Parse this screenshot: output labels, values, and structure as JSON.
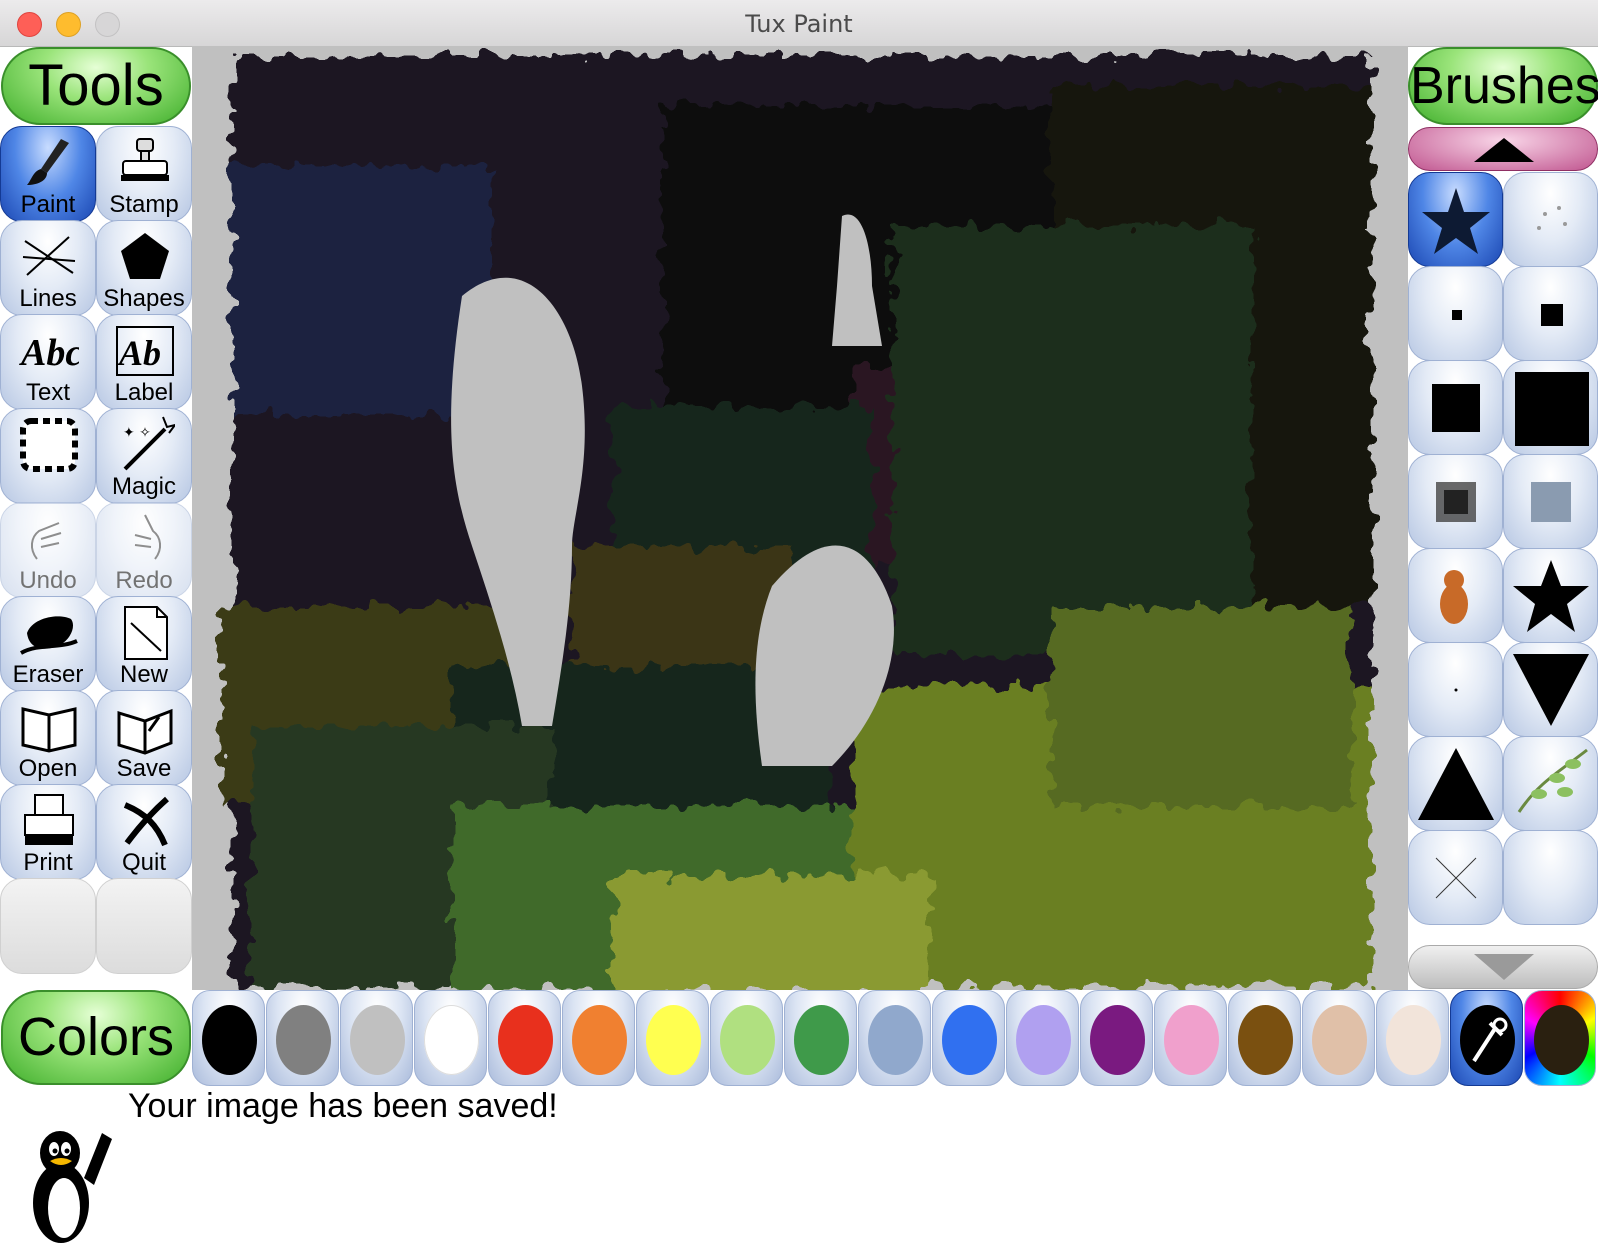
{
  "window": {
    "title": "Tux Paint"
  },
  "tools": {
    "header": "Tools",
    "items": [
      {
        "label": "Paint",
        "icon": "paintbrush-icon",
        "selected": true
      },
      {
        "label": "Stamp",
        "icon": "stamp-icon"
      },
      {
        "label": "Lines",
        "icon": "lines-icon"
      },
      {
        "label": "Shapes",
        "icon": "pentagon-icon"
      },
      {
        "label": "Text",
        "icon": "text-abc-icon"
      },
      {
        "label": "Label",
        "icon": "label-icon"
      },
      {
        "label": "",
        "icon": "fill-icon"
      },
      {
        "label": "Magic",
        "icon": "magic-wand-icon"
      },
      {
        "label": "Undo",
        "icon": "undo-hand-icon",
        "disabled": true
      },
      {
        "label": "Redo",
        "icon": "redo-hand-icon",
        "disabled": true
      },
      {
        "label": "Eraser",
        "icon": "eraser-icon"
      },
      {
        "label": "New",
        "icon": "new-page-icon"
      },
      {
        "label": "Open",
        "icon": "open-book-icon"
      },
      {
        "label": "Save",
        "icon": "save-book-icon"
      },
      {
        "label": "Print",
        "icon": "printer-icon"
      },
      {
        "label": "Quit",
        "icon": "quit-x-icon"
      }
    ]
  },
  "brushes": {
    "header": "Brushes",
    "items": [
      {
        "icon": "starfish-brush-icon",
        "selected": true
      },
      {
        "icon": "spray-brush-icon"
      },
      {
        "icon": "small-square-brush-icon"
      },
      {
        "icon": "medium-square-brush-icon"
      },
      {
        "icon": "large-square-brush-icon"
      },
      {
        "icon": "xlarge-square-brush-icon"
      },
      {
        "icon": "fuzzy-square-brush-icon"
      },
      {
        "icon": "soft-square-brush-icon"
      },
      {
        "icon": "squirrel-brush-icon"
      },
      {
        "icon": "star-brush-icon"
      },
      {
        "icon": "dot-brush-icon"
      },
      {
        "icon": "triangle-down-brush-icon"
      },
      {
        "icon": "triangle-up-brush-icon"
      },
      {
        "icon": "vine-brush-icon"
      },
      {
        "icon": "cross-brush-icon"
      },
      {
        "icon": "empty-brush-icon"
      }
    ]
  },
  "colors": {
    "header": "Colors",
    "swatches": [
      "#000000",
      "#808080",
      "#c0c0c0",
      "#ffffff",
      "#e8301d",
      "#f08030",
      "#ffff50",
      "#b0e080",
      "#3f9a4a",
      "#90a8cc",
      "#3070f0",
      "#b0a0f0",
      "#7a1a80",
      "#f0a0cc",
      "#7a5010",
      "#e0c0a8",
      "#f2e4da"
    ],
    "picker_icon": "eyedropper-icon",
    "current_color": "#2a2010"
  },
  "status": {
    "message": "Your image has been saved!",
    "mascot": "tux-penguin-icon"
  }
}
